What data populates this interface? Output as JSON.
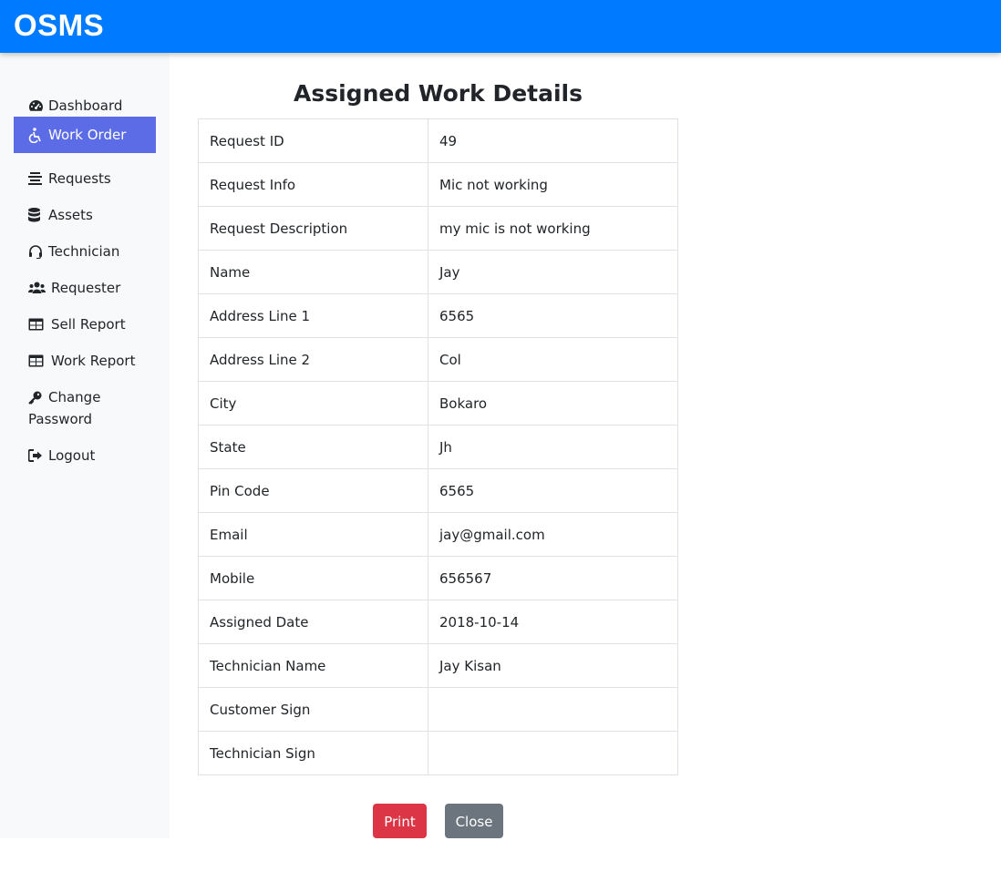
{
  "header": {
    "brand": "OSMS",
    "color": "#007bff"
  },
  "sidebar": {
    "items": [
      {
        "label": "Dashboard",
        "icon": "tachometer-icon",
        "active": false
      },
      {
        "label": "Work Order",
        "icon": "wheelchair-icon",
        "active": true
      },
      {
        "label": "Requests",
        "icon": "align-center-icon",
        "active": false
      },
      {
        "label": "Assets",
        "icon": "database-icon",
        "active": false
      },
      {
        "label": "Technician",
        "icon": "headset-icon",
        "active": false
      },
      {
        "label": "Requester",
        "icon": "users-icon",
        "active": false
      },
      {
        "label": "Sell Report",
        "icon": "table-icon",
        "active": false
      },
      {
        "label": "Work Report",
        "icon": "table-icon",
        "active": false
      },
      {
        "label": "Change Password",
        "icon": "key-icon",
        "active": false
      },
      {
        "label": "Logout",
        "icon": "sign-out-icon",
        "active": false
      }
    ],
    "active_color": "#5b6ce6"
  },
  "main": {
    "title": "Assigned Work Details",
    "rows": [
      {
        "label": "Request ID",
        "value": "49"
      },
      {
        "label": "Request Info",
        "value": "Mic not working"
      },
      {
        "label": "Request Description",
        "value": "my mic is not working"
      },
      {
        "label": "Name",
        "value": "Jay"
      },
      {
        "label": "Address Line 1",
        "value": "6565"
      },
      {
        "label": "Address Line 2",
        "value": "Col"
      },
      {
        "label": "City",
        "value": "Bokaro"
      },
      {
        "label": "State",
        "value": "Jh"
      },
      {
        "label": "Pin Code",
        "value": "6565"
      },
      {
        "label": "Email",
        "value": "jay@gmail.com"
      },
      {
        "label": "Mobile",
        "value": "656567"
      },
      {
        "label": "Assigned Date",
        "value": "2018-10-14"
      },
      {
        "label": "Technician Name",
        "value": "Jay Kisan"
      },
      {
        "label": "Customer Sign",
        "value": ""
      },
      {
        "label": "Technician Sign",
        "value": ""
      }
    ],
    "buttons": {
      "print": {
        "label": "Print",
        "color": "#dc3545"
      },
      "close": {
        "label": "Close",
        "color": "#6c757d"
      }
    }
  }
}
